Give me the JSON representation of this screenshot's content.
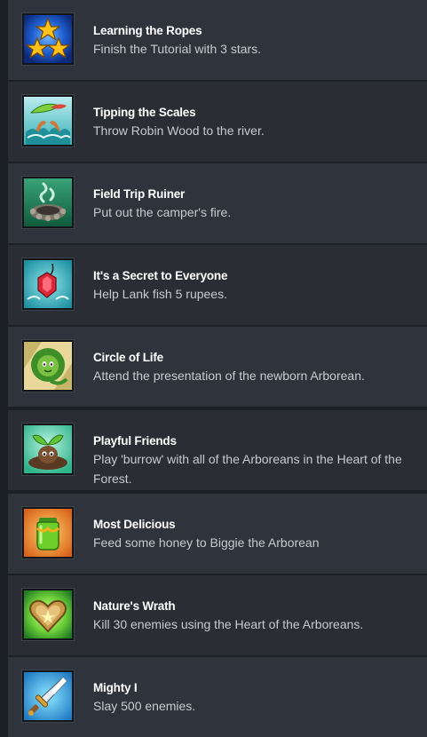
{
  "achievements": [
    {
      "title": "Learning the Ropes",
      "description": "Finish the Tutorial with 3 stars.",
      "icon": "three-stars-icon"
    },
    {
      "title": "Tipping the Scales",
      "description": "Throw Robin Wood to the river.",
      "icon": "river-splash-icon"
    },
    {
      "title": "Field Trip Ruiner",
      "description": "Put out the camper's fire.",
      "icon": "campfire-smoke-icon"
    },
    {
      "title": "It's a Secret to Everyone",
      "description": "Help Lank fish 5 rupees.",
      "icon": "rupee-fishing-icon"
    },
    {
      "title": "Circle of Life",
      "description": "Attend the presentation of the newborn Arborean.",
      "icon": "lion-arborean-icon"
    },
    {
      "title": "Playful Friends",
      "description": "Play 'burrow' with all of the Arboreans in the Heart of the Forest.",
      "icon": "sprout-creature-icon"
    },
    {
      "title": "Most Delicious",
      "description": "Feed some honey to Biggie the Arborean",
      "icon": "honey-jar-icon"
    },
    {
      "title": "Nature's Wrath",
      "description": "Kill 30 enemies using the Heart of the Arboreans.",
      "icon": "wooden-heart-icon"
    },
    {
      "title": "Mighty I",
      "description": "Slay 500 enemies.",
      "icon": "sword-icon"
    }
  ]
}
